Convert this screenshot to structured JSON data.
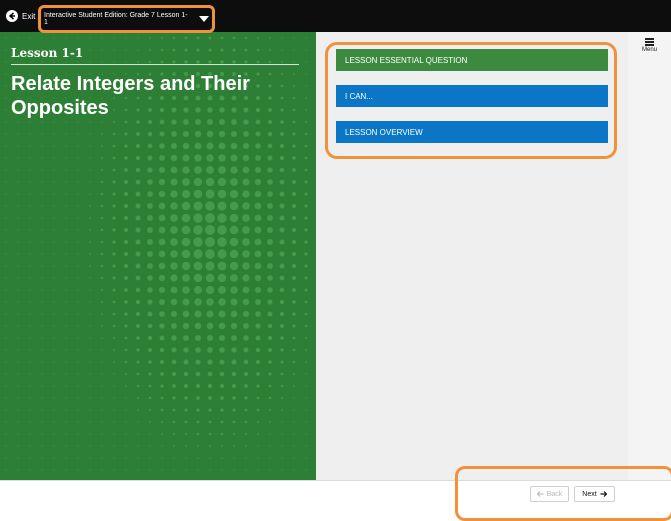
{
  "topbar": {
    "exit_label": "Exit",
    "edition_label": "Interactive Student Edition: Grade 7 Lesson 1-1"
  },
  "hero": {
    "lesson_number": "Lesson 1-1",
    "lesson_title": "Relate Integers and Their Opposites"
  },
  "sections": [
    {
      "label": "LESSON ESSENTIAL QUESTION",
      "color": "#3c8a3f"
    },
    {
      "label": "I CAN...",
      "color": "#0b75c6"
    },
    {
      "label": "LESSON OVERVIEW",
      "color": "#0b75c6"
    }
  ],
  "menu": {
    "label": "Menu"
  },
  "navigation": {
    "back_label": "Back",
    "next_label": "Next"
  },
  "colors": {
    "hero_green": "#2e7f36",
    "highlight_orange": "#f0913b",
    "topbar": "#0d0d0d"
  }
}
